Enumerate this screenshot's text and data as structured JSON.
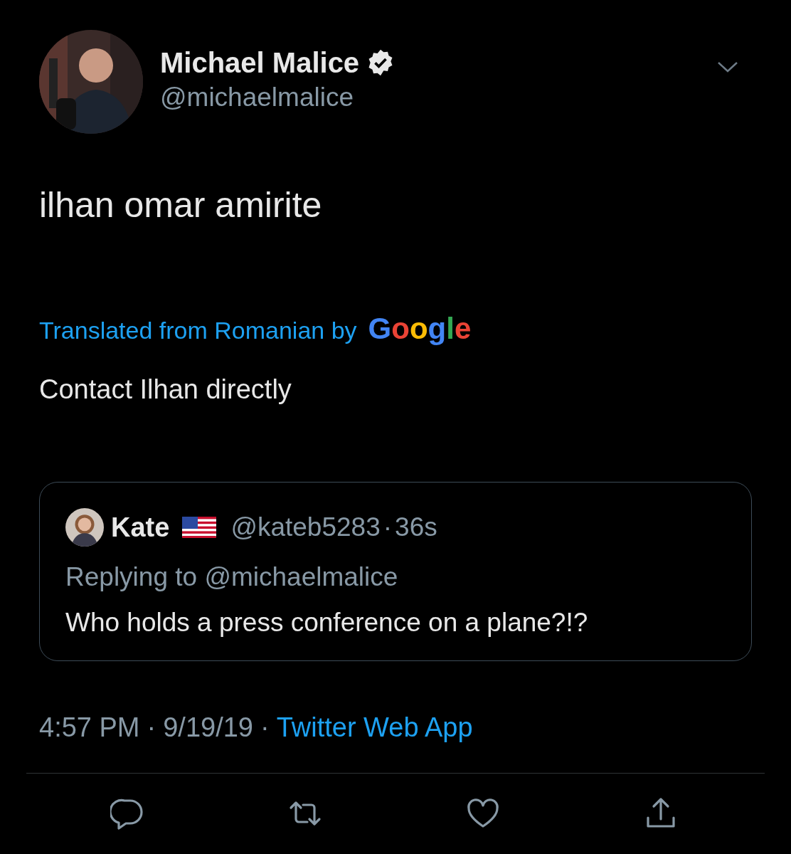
{
  "author": {
    "name": "Michael Malice",
    "verified": true,
    "handle": "@michaelmalice"
  },
  "tweet": {
    "text": "ilhan omar amirite",
    "translation_note": "Translated from Romanian by",
    "translator": "Google",
    "translated_text": "Contact Ilhan directly"
  },
  "quoted": {
    "name": "Kate",
    "handle": "@kateb5283",
    "separator": "·",
    "age": "36s",
    "replying": "Replying to @michaelmalice",
    "text": "Who holds a press conference on a plane?!?"
  },
  "meta": {
    "time": "4:57 PM",
    "sep1": "·",
    "date": "9/19/19",
    "sep2": "·",
    "source": "Twitter Web App"
  }
}
